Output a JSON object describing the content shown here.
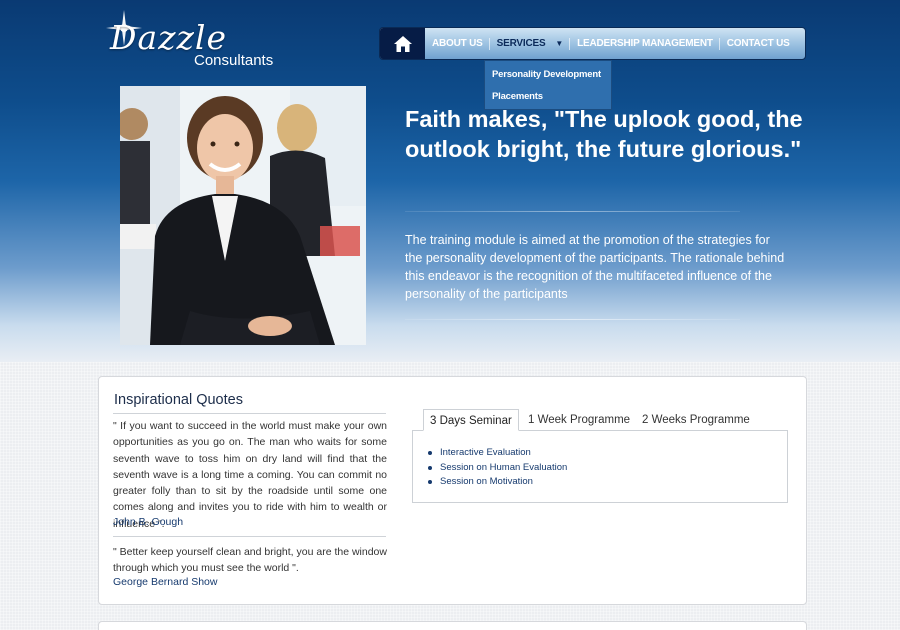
{
  "logo": {
    "script": "Dazzle",
    "sub": "Consultants"
  },
  "nav": {
    "home_icon": "home-icon",
    "items": [
      {
        "label": "About Us"
      },
      {
        "label": "Services"
      },
      {
        "label": "Leadership Management"
      },
      {
        "label": "Contact Us"
      }
    ],
    "dropdown": [
      "Personality Development",
      "Placements"
    ]
  },
  "hero": {
    "quote": "Faith makes, \"The uplook good, the outlook bright, the future glorious.\"",
    "description": "The training module is aimed at the promotion of the strategies for the personality development of the participants. The rationale behind this endeavor is the recognition of the multifaceted influence of the personality of the participants"
  },
  "quotes": {
    "title": "Inspirational Quotes",
    "items": [
      {
        "text": "\" If you want to succeed in the world must make your own opportunities as you go on. The man who waits for some seventh wave to toss him on dry land will find that the seventh wave is a long time a coming. You can commit no greater folly than to sit by the roadside until some one comes along and invites you to ride with him to wealth or influence \".",
        "author": "John B. Gough"
      },
      {
        "text": "\" Better keep yourself clean and bright, you are the window through which you must see the world \".",
        "author": "George Bernard Show"
      }
    ]
  },
  "tabs": {
    "labels": [
      "3 Days Seminar",
      "1 Week Programme",
      "2 Weeks Programme"
    ],
    "active_items": [
      "Interactive Evaluation",
      "Session on Human Evaluation",
      "Session on Motivation"
    ]
  },
  "colors": {
    "nav_dark": "#061c46",
    "accent_blue": "#163a6e",
    "hero_top": "#0a3a73"
  }
}
